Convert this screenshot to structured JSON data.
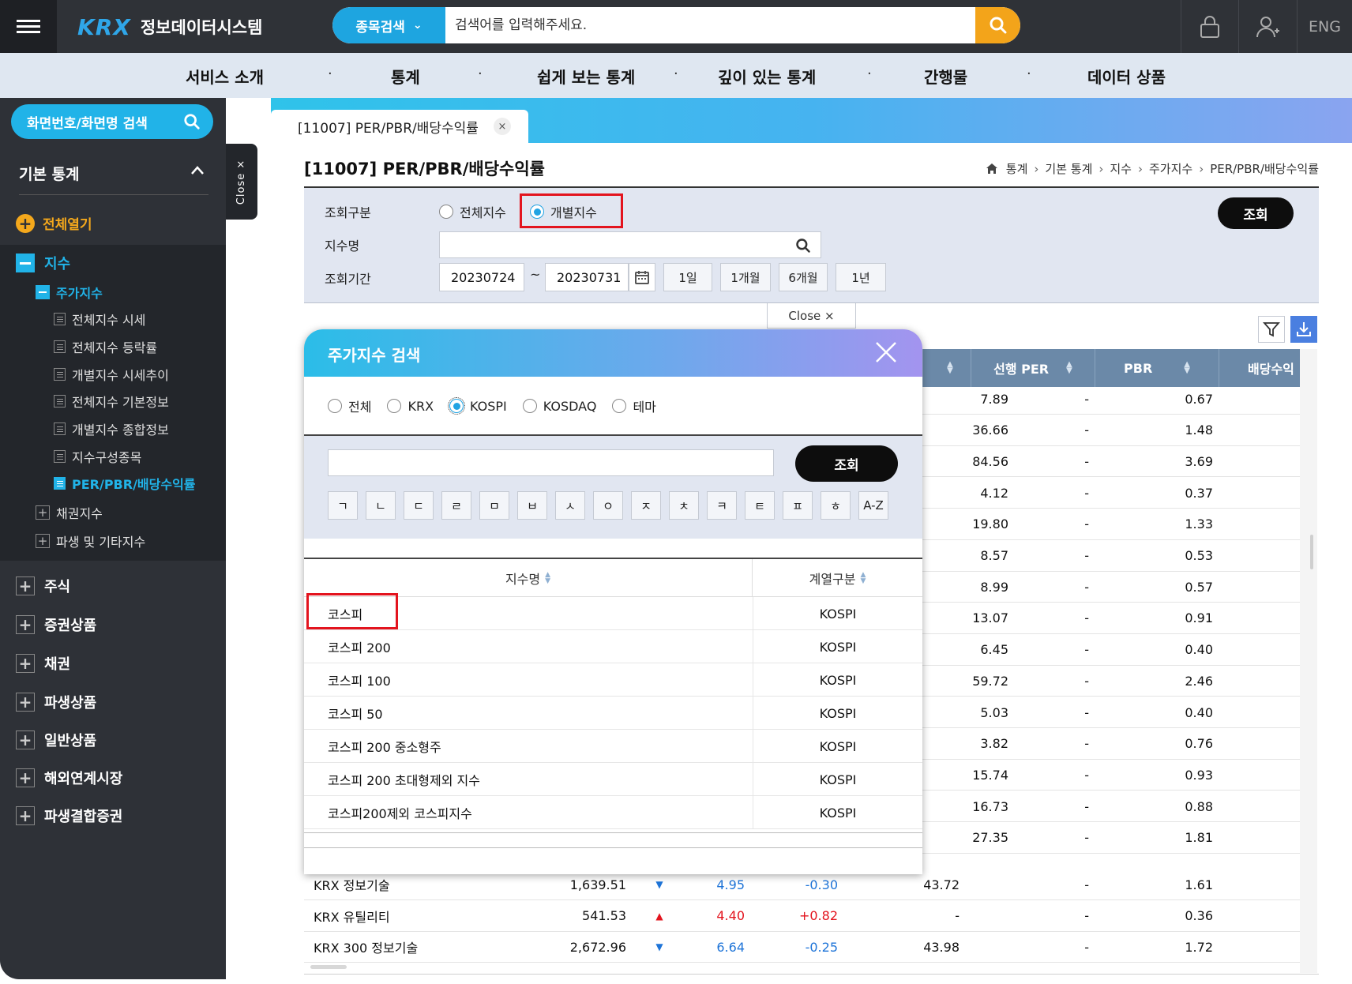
{
  "header": {
    "logo": "KRX",
    "system_name": "정보데이터시스템",
    "search_category": "종목검색",
    "search_placeholder": "검색어를 입력해주세요.",
    "lang": "ENG"
  },
  "mainnav": [
    "서비스 소개",
    "통계",
    "쉽게 보는 통계",
    "깊이 있는 통계",
    "간행물",
    "데이터 상품"
  ],
  "sidebar": {
    "search_label": "화면번호/화면명 검색",
    "section_title": "기본 통계",
    "expand_all": "전체열기",
    "tree": {
      "level1": "지수",
      "level2": "주가지수",
      "items": [
        "전체지수 시세",
        "전체지수 등락률",
        "개별지수 시세추이",
        "전체지수 기본정보",
        "개별지수 종합정보",
        "지수구성종목",
        "PER/PBR/배당수익률"
      ],
      "collapsed": [
        "채권지수",
        "파생 및 기타지수"
      ]
    },
    "categories": [
      "주식",
      "증권상품",
      "채권",
      "파생상품",
      "일반상품",
      "해외연계시장",
      "파생결합증권"
    ],
    "close_tab": "Close ×"
  },
  "tab": {
    "label": "[11007] PER/PBR/배당수익률",
    "close": "×"
  },
  "page": {
    "title": "[11007] PER/PBR/배당수익률",
    "breadcrumb": [
      "통계",
      "기본 통계",
      "지수",
      "주가지수",
      "PER/PBR/배당수익률"
    ]
  },
  "filter": {
    "type_label": "조회구분",
    "type_options": [
      "전체지수",
      "개별지수"
    ],
    "type_selected": "개별지수",
    "name_label": "지수명",
    "period_label": "조회기간",
    "date_from": "20230724",
    "date_sep": "~",
    "date_to": "20230731",
    "period_buttons": [
      "1일",
      "1개월",
      "6개월",
      "1년"
    ],
    "query_button": "조회",
    "close_handle": "Close ×"
  },
  "table": {
    "headers": [
      "선행 PER",
      "PBR",
      "배당수익"
    ],
    "rows": [
      {
        "per": "7.89",
        "fper": "-",
        "pbr": "0.67"
      },
      {
        "per": "36.66",
        "fper": "-",
        "pbr": "1.48"
      },
      {
        "per": "84.56",
        "fper": "-",
        "pbr": "3.69"
      },
      {
        "per": "4.12",
        "fper": "-",
        "pbr": "0.37"
      },
      {
        "per": "19.80",
        "fper": "-",
        "pbr": "1.33"
      },
      {
        "per": "8.57",
        "fper": "-",
        "pbr": "0.53"
      },
      {
        "per": "8.99",
        "fper": "-",
        "pbr": "0.57"
      },
      {
        "per": "13.07",
        "fper": "-",
        "pbr": "0.91"
      },
      {
        "per": "6.45",
        "fper": "-",
        "pbr": "0.40"
      },
      {
        "per": "59.72",
        "fper": "-",
        "pbr": "2.46"
      },
      {
        "per": "5.03",
        "fper": "-",
        "pbr": "0.40"
      },
      {
        "per": "3.82",
        "fper": "-",
        "pbr": "0.76"
      },
      {
        "per": "15.74",
        "fper": "-",
        "pbr": "0.93"
      },
      {
        "per": "16.73",
        "fper": "-",
        "pbr": "0.88"
      },
      {
        "per": "27.35",
        "fper": "-",
        "pbr": "1.81"
      }
    ],
    "full_rows": [
      {
        "name": "KRX 정보기술",
        "close": "1,639.51",
        "dir": "▼",
        "chg": "4.95",
        "rate": "-0.30",
        "per": "43.72",
        "fper": "-",
        "pbr": "1.61"
      },
      {
        "name": "KRX 유틸리티",
        "close": "541.53",
        "dir": "▲",
        "chg": "4.40",
        "rate": "+0.82",
        "per": "-",
        "fper": "-",
        "pbr": "0.36"
      },
      {
        "name": "KRX 300 정보기술",
        "close": "2,672.96",
        "dir": "▼",
        "chg": "6.64",
        "rate": "-0.25",
        "per": "43.98",
        "fper": "-",
        "pbr": "1.72"
      }
    ]
  },
  "modal": {
    "title": "주가지수 검색",
    "radios": [
      "전체",
      "KRX",
      "KOSPI",
      "KOSDAQ",
      "테마"
    ],
    "radio_selected": "KOSPI",
    "query_button": "조회",
    "consonants": [
      "ㄱ",
      "ㄴ",
      "ㄷ",
      "ㄹ",
      "ㅁ",
      "ㅂ",
      "ㅅ",
      "ㅇ",
      "ㅈ",
      "ㅊ",
      "ㅋ",
      "ㅌ",
      "ㅍ",
      "ㅎ",
      "A-Z"
    ],
    "col_name": "지수명",
    "col_group": "계열구분",
    "rows": [
      {
        "name": "코스피",
        "group": "KOSPI"
      },
      {
        "name": "코스피 200",
        "group": "KOSPI"
      },
      {
        "name": "코스피 100",
        "group": "KOSPI"
      },
      {
        "name": "코스피 50",
        "group": "KOSPI"
      },
      {
        "name": "코스피 200 중소형주",
        "group": "KOSPI"
      },
      {
        "name": "코스피 200 초대형제외 지수",
        "group": "KOSPI"
      },
      {
        "name": "코스피200제외 코스피지수",
        "group": "KOSPI"
      }
    ]
  },
  "colors": {
    "accent": "#21b3e8",
    "highlight": "#e3141e",
    "up": "#e3141e",
    "down": "#1e74d8"
  }
}
